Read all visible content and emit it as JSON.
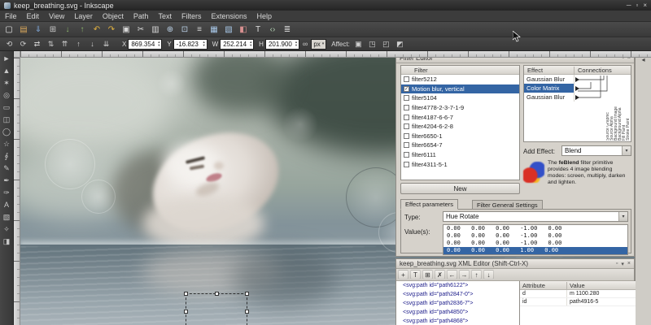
{
  "titlebar": {
    "title": "keep_breathing.svg - Inkscape",
    "minimize_icon": "─",
    "maximize_icon": "▫",
    "close_icon": "×"
  },
  "menubar": {
    "items": [
      "File",
      "Edit",
      "View",
      "Layer",
      "Object",
      "Path",
      "Text",
      "Filters",
      "Extensions",
      "Help"
    ]
  },
  "toolbar_main": {
    "icons": [
      {
        "name": "new-document-icon",
        "glyph": "▢",
        "color": "#e8e8e8"
      },
      {
        "name": "open-icon",
        "glyph": "▤",
        "color": "#d9a85c"
      },
      {
        "name": "save-icon",
        "glyph": "⇓",
        "color": "#7fa7d8"
      },
      {
        "name": "print-icon",
        "glyph": "⊞",
        "color": "#c9c9c9"
      },
      {
        "name": "import-icon",
        "glyph": "↓",
        "color": "#8fba6e"
      },
      {
        "name": "export-icon",
        "glyph": "↑",
        "color": "#8fba6e"
      },
      {
        "name": "undo-icon",
        "glyph": "↶",
        "color": "#e3b341"
      },
      {
        "name": "redo-icon",
        "glyph": "↷",
        "color": "#e3b341"
      },
      {
        "name": "copy-icon",
        "glyph": "▣",
        "color": "#d8d8d8"
      },
      {
        "name": "cut-icon",
        "glyph": "✂",
        "color": "#d8d8d8"
      },
      {
        "name": "paste-icon",
        "glyph": "▥",
        "color": "#d8d8d8"
      },
      {
        "name": "zoom-drawing-icon",
        "glyph": "⊕",
        "color": "#bcd2e8"
      },
      {
        "name": "zoom-page-icon",
        "glyph": "⊡",
        "color": "#bcd2e8"
      },
      {
        "name": "duplicate-icon",
        "glyph": "≡",
        "color": "#d8d8d8"
      },
      {
        "name": "group-icon",
        "glyph": "▦",
        "color": "#a8c8e8"
      },
      {
        "name": "ungroup-icon",
        "glyph": "▧",
        "color": "#a8c8e8"
      },
      {
        "name": "fill-stroke-icon",
        "glyph": "◧",
        "color": "#d89090"
      },
      {
        "name": "text-tool-shortcut-icon",
        "glyph": "T",
        "color": "#e0e0e0"
      },
      {
        "name": "xml-editor-icon",
        "glyph": "‹›",
        "color": "#b0d0b0"
      },
      {
        "name": "align-dialog-icon",
        "glyph": "≣",
        "color": "#d0d0d0"
      }
    ]
  },
  "toolbar_options": {
    "icons_left": [
      {
        "name": "rotate-ccw-icon",
        "glyph": "⟲"
      },
      {
        "name": "rotate-cw-icon",
        "glyph": "⟳"
      },
      {
        "name": "flip-horizontal-icon",
        "glyph": "⇄"
      },
      {
        "name": "flip-vertical-icon",
        "glyph": "⇅"
      },
      {
        "name": "raise-to-top-icon",
        "glyph": "⇈"
      },
      {
        "name": "raise-icon",
        "glyph": "↑"
      },
      {
        "name": "lower-icon",
        "glyph": "↓"
      },
      {
        "name": "lower-to-bottom-icon",
        "glyph": "⇊"
      }
    ],
    "fields": [
      {
        "name": "x-field",
        "label": "X",
        "value": "869.354"
      },
      {
        "name": "y-field",
        "label": "Y",
        "value": "-16.823"
      },
      {
        "name": "w-field",
        "label": "W",
        "value": "252.214"
      },
      {
        "name": "h-field",
        "label": "H",
        "value": "201.900"
      }
    ],
    "lock_glyph": "∞",
    "unit": "px",
    "affect_label": "Affect:",
    "affect_icons": [
      {
        "name": "affect-move-gradients-icon",
        "glyph": "▣"
      },
      {
        "name": "affect-transform-stroke-icon",
        "glyph": "◳"
      },
      {
        "name": "affect-transform-corners-icon",
        "glyph": "◰"
      },
      {
        "name": "affect-transform-patterns-icon",
        "glyph": "◩"
      }
    ],
    "spin_up": "▲",
    "spin_down": "▼"
  },
  "toolbox": {
    "tools": [
      {
        "name": "selector-tool",
        "glyph": "►"
      },
      {
        "name": "node-tool",
        "glyph": "▲"
      },
      {
        "name": "tweak-tool",
        "glyph": "✶"
      },
      {
        "name": "zoom-tool",
        "glyph": "◎"
      },
      {
        "name": "rectangle-tool",
        "glyph": "▭"
      },
      {
        "name": "box3d-tool",
        "glyph": "◫"
      },
      {
        "name": "ellipse-tool",
        "glyph": "◯"
      },
      {
        "name": "star-tool",
        "glyph": "☆"
      },
      {
        "name": "spiral-tool",
        "glyph": "∮"
      },
      {
        "name": "pencil-tool",
        "glyph": "✎"
      },
      {
        "name": "pen-tool",
        "glyph": "✒"
      },
      {
        "name": "calligraphy-tool",
        "glyph": "✑"
      },
      {
        "name": "text-tool",
        "glyph": "A"
      },
      {
        "name": "gradient-tool",
        "glyph": "▧"
      },
      {
        "name": "dropper-tool",
        "glyph": "✧"
      },
      {
        "name": "paint-bucket-tool",
        "glyph": "◨"
      }
    ]
  },
  "filter_editor": {
    "title": "Filter Editor",
    "header_icons": [
      {
        "name": "dock-float-icon",
        "glyph": "▫"
      },
      {
        "name": "dock-close-icon",
        "glyph": "×"
      }
    ],
    "filter_col_header": "Filter",
    "filters": [
      {
        "name": "filter5212",
        "checked": false,
        "selected": false
      },
      {
        "name": "Motion blur, vertical",
        "checked": true,
        "selected": true
      },
      {
        "name": "filter5104",
        "checked": false,
        "selected": false
      },
      {
        "name": "filter4778-2-3-7-1-9",
        "checked": false,
        "selected": false
      },
      {
        "name": "filter4187-6-6-7",
        "checked": false,
        "selected": false
      },
      {
        "name": "filter4204-6-2-8",
        "checked": false,
        "selected": false
      },
      {
        "name": "filter6650-1",
        "checked": false,
        "selected": false
      },
      {
        "name": "filter6654-7",
        "checked": false,
        "selected": false
      },
      {
        "name": "filter6111",
        "checked": false,
        "selected": false
      },
      {
        "name": "filter4311-5-1",
        "checked": false,
        "selected": false
      }
    ],
    "new_button": "New",
    "effect_header": "Effect",
    "connections_header": "Connections",
    "effects": [
      {
        "name": "Gaussian Blur",
        "selected": false
      },
      {
        "name": "Color Matrix",
        "selected": true
      },
      {
        "name": "Gaussian Blur",
        "selected": false
      }
    ],
    "inputs": [
      "Source Graphic",
      "Source Alpha",
      "Background Image",
      "Background Alpha",
      "Fill Paint",
      "Stroke Paint"
    ],
    "add_effect_label": "Add Effect:",
    "add_effect_value": "Blend",
    "description_pre": "The ",
    "description_bold": "feBlend",
    "description_post": " filter primitive provides 4 image blending modes: screen, multiply, darken and lighten.",
    "tabs": {
      "params": "Effect parameters",
      "general": "Filter General Settings"
    },
    "type_label": "Type:",
    "type_value": "Hue Rotate",
    "values_label": "Value(s):",
    "matrix": [
      {
        "text": "0.00 0.00 0.00 -1.00 0.00",
        "selected": false
      },
      {
        "text": "0.00 0.00 0.00 -1.00 0.00",
        "selected": false
      },
      {
        "text": "0.00 0.00 0.00 -1.00 0.00",
        "selected": false
      },
      {
        "text": "0.00 0.00 0.00 1.00 0.00",
        "selected": true
      }
    ]
  },
  "xml_editor": {
    "title": "keep_breathing.svg XML Editor (Shift-Ctrl-X)",
    "header_icons": [
      {
        "name": "dock-float-icon",
        "glyph": "▫"
      },
      {
        "name": "dock-collapse-icon",
        "glyph": "▾"
      },
      {
        "name": "dock-close-icon",
        "glyph": "×"
      }
    ],
    "toolbar_icons": [
      {
        "name": "new-element-node-icon",
        "glyph": "+"
      },
      {
        "name": "new-text-node-icon",
        "glyph": "T"
      },
      {
        "name": "duplicate-node-icon",
        "glyph": "⊞"
      },
      {
        "name": "delete-node-icon",
        "glyph": "✗"
      },
      {
        "name": "unindent-node-icon",
        "glyph": "←"
      },
      {
        "name": "indent-node-icon",
        "glyph": "→"
      },
      {
        "name": "move-node-up-icon",
        "glyph": "↑"
      },
      {
        "name": "move-node-down-icon",
        "glyph": "↓"
      }
    ],
    "nodes": [
      "<svg:path id=\"path6122\">",
      "<svg:path id=\"path2847-0\">",
      "<svg:path id=\"path2836-7\">",
      "<svg:path id=\"path4850\">",
      "<svg:path id=\"path4868\">"
    ],
    "attr_header": "Attribute",
    "value_header": "Value",
    "attr_rows": [
      {
        "attribute": "d",
        "value": "m 1100.280"
      },
      {
        "attribute": "id",
        "value": "path4916-5"
      }
    ]
  },
  "ui": {
    "dropdown_arrow": "▾",
    "dock_collapse": "◂",
    "connector_glyph": "▸"
  }
}
